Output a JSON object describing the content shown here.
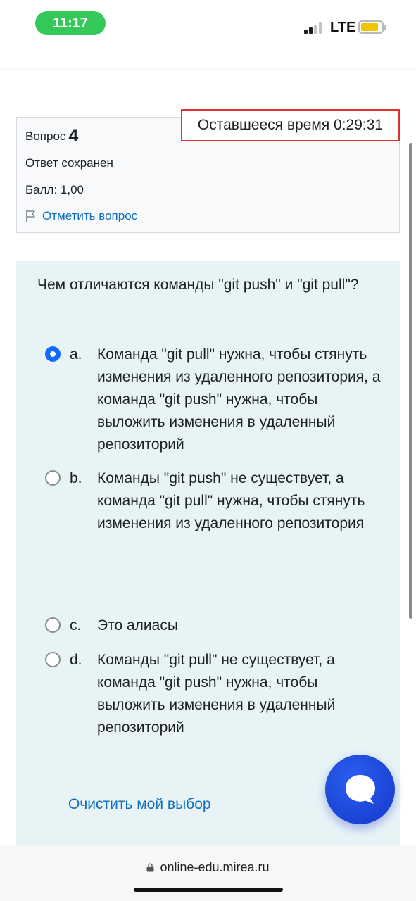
{
  "status_bar": {
    "time": "11:17",
    "network": "LTE",
    "battery_color": "#f2c300",
    "time_pill_color": "#34c759"
  },
  "question_info": {
    "question_word": "Вопрос",
    "question_number": "4",
    "state": "Ответ сохранен",
    "grade": "Балл: 1,00",
    "flag_label": "Отметить вопрос"
  },
  "timer": {
    "text": "Оставшееся время 0:29:31"
  },
  "question": {
    "text": "Чем отличаются команды \"git push\" и \"git pull\"?",
    "options": [
      {
        "letter": "a.",
        "text": "Команда \"git pull\" нужна, чтобы стянуть изменения из удаленного репозитория, а команда \"git push\" нужна, чтобы выложить изменения в удаленный репозиторий",
        "selected": true
      },
      {
        "letter": "b.",
        "text": "Команды \"git push\" не существует, а команда \"git pull\" нужна, чтобы стянуть изменения из удаленного репозитория",
        "selected": false
      },
      {
        "letter": "c.",
        "text": "Это алиасы",
        "selected": false
      },
      {
        "letter": "d.",
        "text": "Команды \"git pull\" не существует, а команда \"git push\" нужна, чтобы выложить изменения в удаленный репозиторий",
        "selected": false
      }
    ],
    "clear_label": "Очистить мой выбор"
  },
  "browser": {
    "url": "online-edu.mirea.ru"
  },
  "colors": {
    "link": "#0f6cbf",
    "timer_border": "#e2302f",
    "content_bg": "#e7f3f5",
    "radio_selected": "#0f6cfb",
    "chat_button": "#1437c9"
  }
}
